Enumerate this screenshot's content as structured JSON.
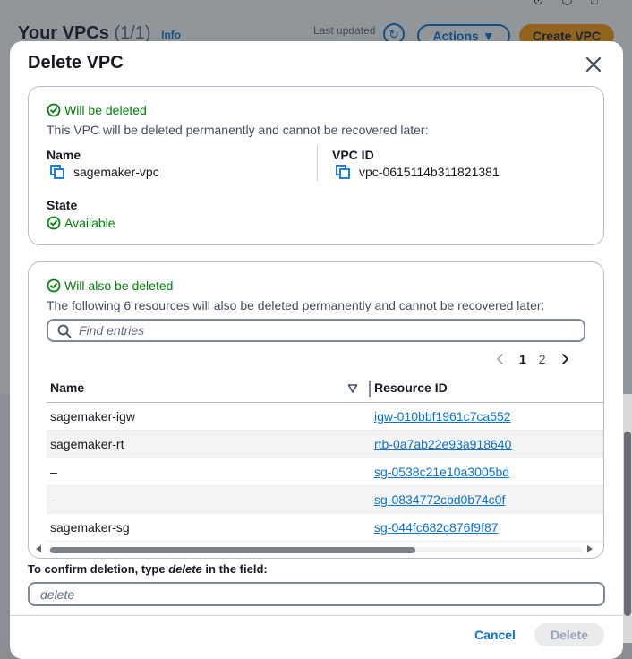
{
  "background": {
    "title": "Your VPCs",
    "count": "(1/1)",
    "info_link": "Info",
    "last_updated": "Last updated",
    "actions_label": "Actions",
    "create_label": "Create VPC"
  },
  "modal": {
    "title": "Delete VPC",
    "vpc_section": {
      "status": "Will be deleted",
      "description": "This VPC will be deleted permanently and cannot be recovered later:",
      "name_label": "Name",
      "name_value": "sagemaker-vpc",
      "vpc_id_label": "VPC ID",
      "vpc_id_value": "vpc-0615114b311821381",
      "state_label": "State",
      "state_value": "Available"
    },
    "resources_section": {
      "status": "Will also be deleted",
      "description": "The following 6 resources will also be deleted permanently and cannot be recovered later:",
      "search_placeholder": "Find entries",
      "pagination": {
        "pages": [
          "1",
          "2"
        ],
        "current": "1"
      },
      "columns": [
        "Name",
        "Resource ID"
      ],
      "rows": [
        {
          "name": "sagemaker-igw",
          "resource_id": "igw-010bbf1961c7ca552"
        },
        {
          "name": "sagemaker-rt",
          "resource_id": "rtb-0a7ab22e93a918640"
        },
        {
          "name": "–",
          "resource_id": "sg-0538c21e10a3005bd"
        },
        {
          "name": "–",
          "resource_id": "sg-0834772cbd0b74c0f"
        },
        {
          "name": "sagemaker-sg",
          "resource_id": "sg-044fc682c876f9f87"
        }
      ]
    },
    "confirm": {
      "prefix": "To confirm deletion, type ",
      "keyword": "delete",
      "suffix": " in the field:",
      "placeholder": "delete"
    },
    "cancel_label": "Cancel",
    "delete_label": "Delete"
  },
  "colors": {
    "success": "#037f0c",
    "link": "#0972d3",
    "primary_orange": "#ff9900",
    "disabled": "#9ba7b6"
  }
}
